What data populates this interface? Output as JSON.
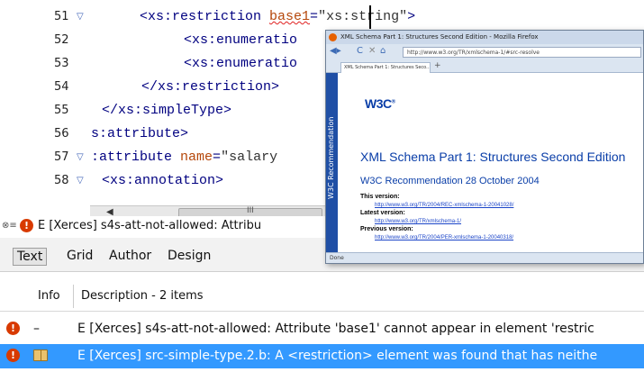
{
  "editor": {
    "lines": [
      {
        "num": "51",
        "fold": "▽",
        "indent": "",
        "tag": "<xs:restriction ",
        "attr": "base1",
        "eq": "=",
        "val": "\"xs:string\"",
        "close": ">"
      },
      {
        "num": "52",
        "fold": "",
        "indent": "",
        "tag": "<xs:enumeratio",
        "attr": "",
        "eq": "",
        "val": "",
        "close": ""
      },
      {
        "num": "53",
        "fold": "",
        "indent": "",
        "tag": "<xs:enumeratio",
        "attr": "",
        "eq": "",
        "val": "",
        "close": ""
      },
      {
        "num": "54",
        "fold": "",
        "indent": "",
        "tag": "</xs:restriction>",
        "attr": "",
        "eq": "",
        "val": "",
        "close": ""
      },
      {
        "num": "55",
        "fold": "",
        "indent": "",
        "tag": "</xs:simpleType>",
        "attr": "",
        "eq": "",
        "val": "",
        "close": ""
      },
      {
        "num": "56",
        "fold": "",
        "indent": "",
        "tag": "s:attribute>",
        "attr": "",
        "eq": "",
        "val": "",
        "close": ""
      },
      {
        "num": "57",
        "fold": "▽",
        "indent": "",
        "tag": ":attribute ",
        "attr": "name",
        "eq": "=",
        "val": "\"salary",
        "close": ""
      },
      {
        "num": "58",
        "fold": "▽",
        "indent": "",
        "tag": "<xs:annotation>",
        "attr": "",
        "eq": "",
        "val": "",
        "close": ""
      }
    ],
    "scroll_left": "◀",
    "scroll_right": "▶",
    "scroll_thumb_grip": "III"
  },
  "error_bar": {
    "prefix_icon": "error-icon",
    "text": "E [Xerces] s4s-att-not-allowed: Attribu"
  },
  "mode_tabs": [
    "Text",
    "Grid",
    "Author",
    "Design"
  ],
  "mode_tabs_active": "Text",
  "problems": {
    "col_info": "Info",
    "col_description": "Description - 2 items",
    "rows": [
      {
        "icon": "error-icon",
        "info": "–",
        "description": "E [Xerces] s4s-att-not-allowed: Attribute 'base1' cannot appear in element 'restric"
      },
      {
        "icon": "error-icon",
        "info": "book-icon",
        "description": "E [Xerces] src-simple-type.2.b: A <restriction> element was found that has neithe"
      }
    ]
  },
  "firefox": {
    "title": "XML Schema Part 1: Structures Second Edition - Mozilla Firefox",
    "url": "http://www.w3.org/TR/xmlschema-1/#src-resolve",
    "tab_label": "XML Schema Part 1: Structures Seco...",
    "new_tab": "+",
    "sidebar_label": "W3C Recommendation",
    "logo": "W3C",
    "logo_mark": "®",
    "heading": "XML Schema Part 1: Structures Second Edition",
    "subheading": "W3C Recommendation 28 October 2004",
    "this_version_label": "This version:",
    "this_version_url": "http://www.w3.org/TR/2004/REC-xmlschema-1-20041028/",
    "latest_version_label": "Latest version:",
    "latest_version_url": "http://www.w3.org/TR/xmlschema-1/",
    "previous_version_label": "Previous version:",
    "previous_version_url": "http://www.w3.org/TR/2004/PER-xmlschema-1-20040318/",
    "status": "Done"
  },
  "colors": {
    "error": "#d83a00",
    "selection": "#3399ff",
    "xml_tag": "#000080",
    "xml_attr": "#b5470a",
    "w3c_blue": "#0a3ea8"
  }
}
